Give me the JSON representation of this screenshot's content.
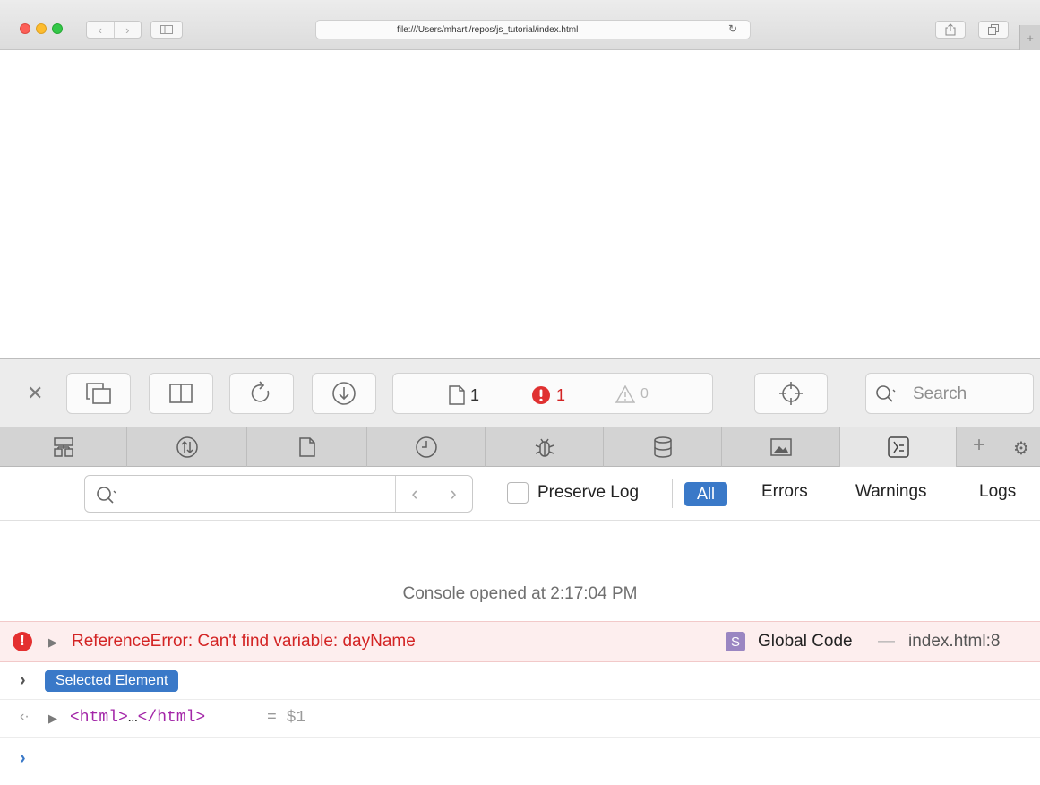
{
  "browser": {
    "address": "file:///Users/mhartl/repos/js_tutorial/index.html"
  },
  "devtools": {
    "dashboard": {
      "resources_count": "1",
      "errors_count": "1",
      "warnings_count": "0"
    },
    "search_placeholder": "Search",
    "filter": {
      "placeholder": "",
      "preserve_log_label": "Preserve Log",
      "levels": [
        "All",
        "Errors",
        "Warnings",
        "Logs"
      ],
      "active_level": "All"
    }
  },
  "console": {
    "opened_message": "Console opened at 2:17:04 PM",
    "error": {
      "message": "ReferenceError: Can't find variable: dayName",
      "function_badge": "S",
      "function": "Global Code",
      "separator": "—",
      "location": "index.html:8"
    },
    "selected_element_label": "Selected Element",
    "result": {
      "open_tag": "<html>",
      "ellipsis": "…",
      "close_tag": "</html>",
      "assignment": "= $1"
    }
  },
  "colors": {
    "accent": "#3a79c8",
    "error": "#d32424",
    "error_bg": "#fdeeee",
    "html_tag": "#a326a8"
  }
}
